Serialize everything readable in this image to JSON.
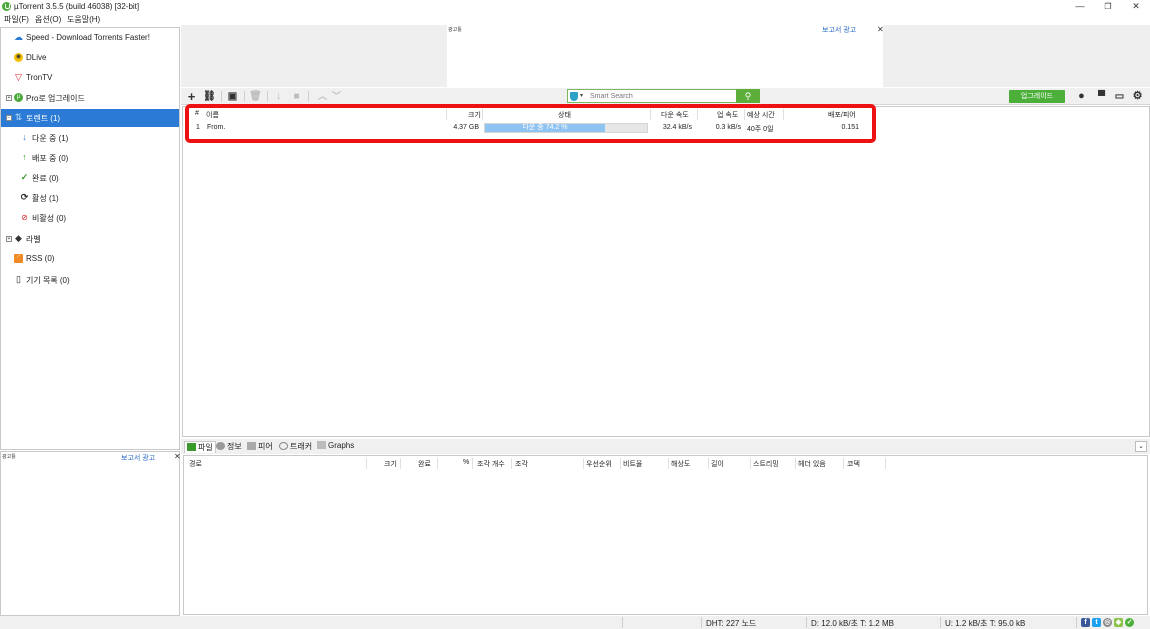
{
  "window": {
    "title": "µTorrent 3.5.5  (build 46038) [32-bit]",
    "minimize": "—",
    "maximize": "❐",
    "close": "✕"
  },
  "menu": [
    "파일(F)",
    "옵션(O)",
    "도움말(H)"
  ],
  "sidebar": {
    "items": [
      {
        "label": "Speed - Download Torrents Faster!",
        "icon": "speed-cloud-icon"
      },
      {
        "label": "DLive",
        "icon": "dlive-icon"
      },
      {
        "label": "TronTV",
        "icon": "trontv-icon"
      },
      {
        "label": "Pro로 업그레이드",
        "icon": "utorrent-pro-icon"
      },
      {
        "label": "토렌트 (1)",
        "icon": "torrents-icon"
      },
      {
        "label": "다운 중 (1)",
        "icon": "download-arrow-icon"
      },
      {
        "label": "배포 중 (0)",
        "icon": "upload-arrow-icon"
      },
      {
        "label": "완료 (0)",
        "icon": "checkmark-icon"
      },
      {
        "label": "활성 (1)",
        "icon": "refresh-icon"
      },
      {
        "label": "비활성 (0)",
        "icon": "inactive-icon"
      },
      {
        "label": "라벨",
        "icon": "tag-icon"
      },
      {
        "label": "RSS (0)",
        "icon": "rss-icon"
      },
      {
        "label": "기기 목록 (0)",
        "icon": "device-icon"
      }
    ]
  },
  "ads": {
    "label": "광고틀",
    "report": "보고서 광고",
    "close": "✕"
  },
  "toolbar": {
    "search_placeholder": "Smart Search",
    "upgrade_label": "업그레이드"
  },
  "torrent_list": {
    "columns": [
      "#",
      "이름",
      "크기",
      "상태",
      "다운 속도",
      "업 속도",
      "예상 시간",
      "배포/피어"
    ],
    "rows": [
      {
        "num": "1",
        "name": "From.",
        "size": "4.37 GB",
        "status": "다운 중 74.2 %",
        "progress": 74.2,
        "down_speed": "32.4 kB/s",
        "up_speed": "0.3 kB/s",
        "eta": "40주 0일",
        "ratio": "0.151"
      }
    ]
  },
  "detail_tabs": [
    "파일",
    "정보",
    "피어",
    "트래커",
    "Graphs"
  ],
  "files_columns": [
    "경로",
    "크기",
    "완료",
    "%",
    "조각 개수",
    "조각",
    "우선순위",
    "비트율",
    "해상도",
    "길이",
    "스트리밍",
    "헤더 있음",
    "코덱"
  ],
  "status_bar": {
    "dht": "DHT: 227 노드",
    "download": "D: 12.0 kB/초 T: 1.2 MB",
    "upload": "U: 1.2 kB/초 T: 95.0 kB"
  },
  "colors": {
    "accent_blue": "#2b7bd6",
    "upgrade_green": "#4caf3a",
    "progress_fill": "#8ec3f2",
    "highlight_red": "#ee1111"
  }
}
